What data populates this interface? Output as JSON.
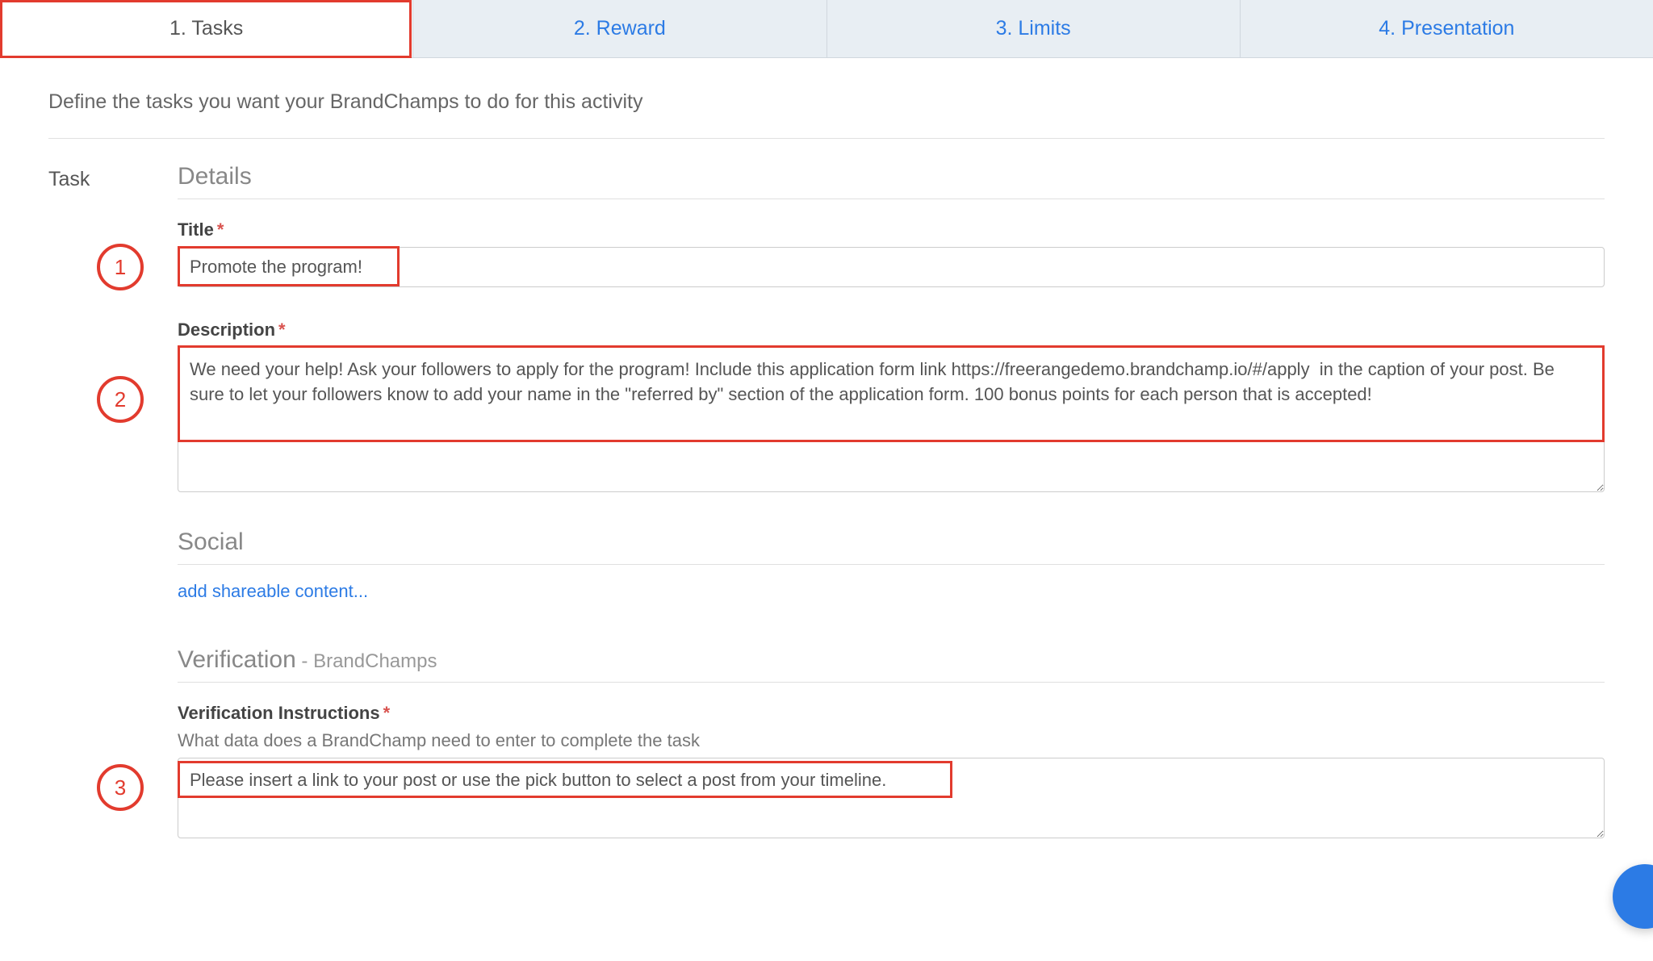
{
  "tabs": {
    "tasks": "1. Tasks",
    "reward": "2. Reward",
    "limits": "3. Limits",
    "presentation": "4. Presentation"
  },
  "intro": "Define the tasks you want your BrandChamps to do for this activity",
  "task_label": "Task",
  "sections": {
    "details": "Details",
    "social": "Social",
    "verification_main": "Verification",
    "verification_sub": " - BrandChamps"
  },
  "fields": {
    "title_label": "Title",
    "title_value": "Promote the program!",
    "desc_label": "Description",
    "desc_value": "We need your help! Ask your followers to apply for the program! Include this application form link https://freerangedemo.brandchamp.io/#/apply  in the caption of your post. Be sure to let your followers know to add your name in the \"referred by\" section of the application form. 100 bonus points for each person that is accepted!",
    "verif_label": "Verification Instructions",
    "verif_helper": "What data does a BrandChamp need to enter to complete the task",
    "verif_value": "Please insert a link to your post or use the pick button to select a post from your timeline."
  },
  "links": {
    "add_shareable": "add shareable content..."
  },
  "callouts": {
    "one": "1",
    "two": "2",
    "three": "3"
  }
}
